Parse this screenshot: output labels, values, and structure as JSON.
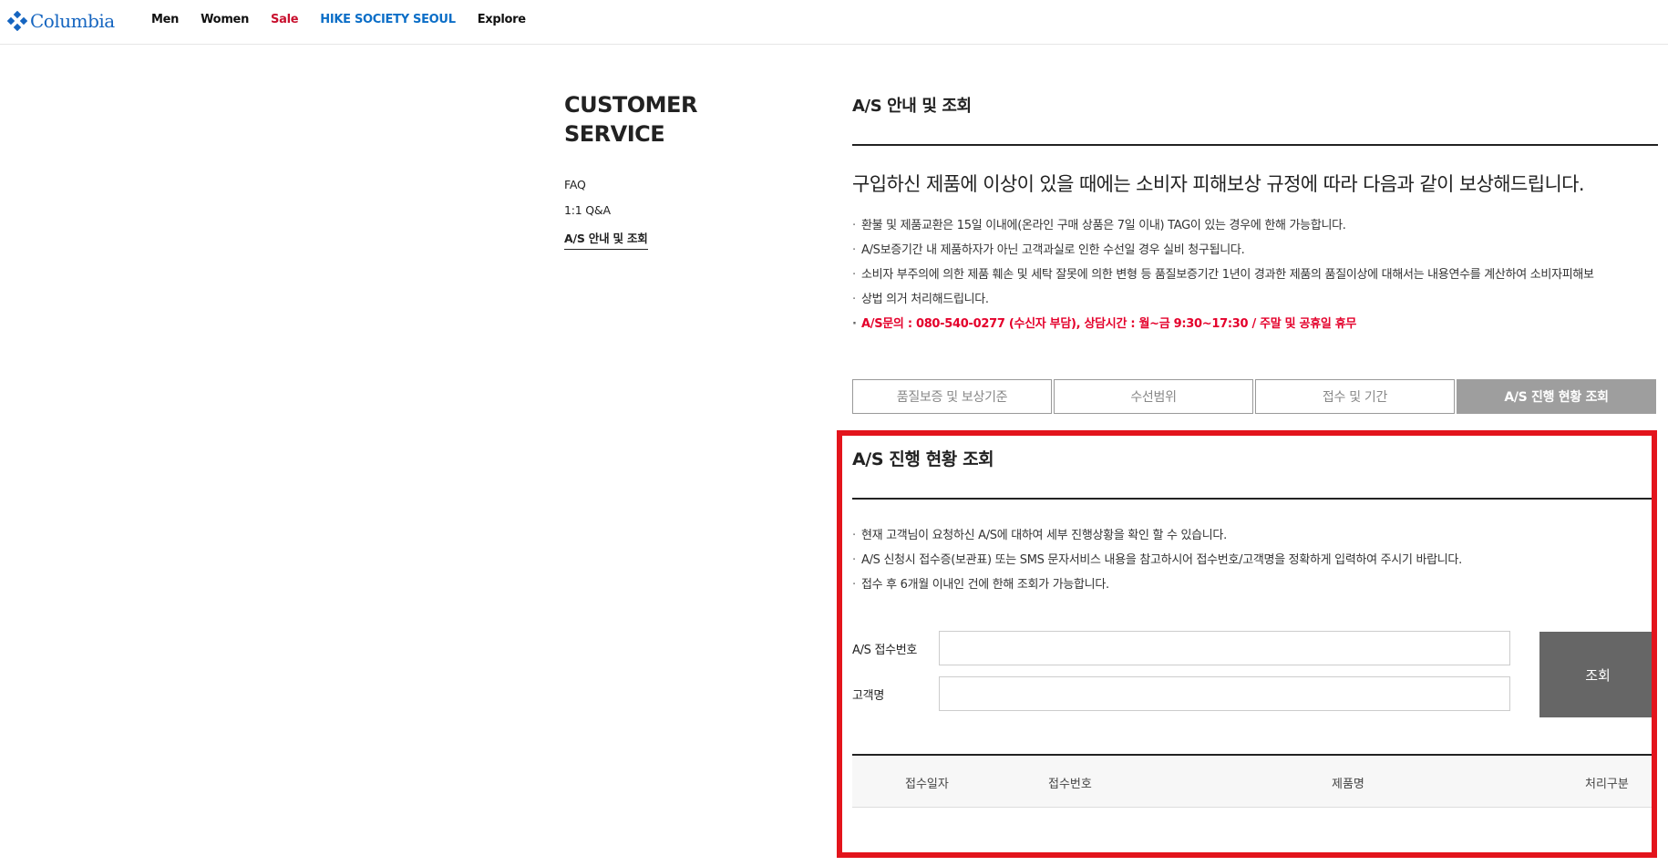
{
  "brand": {
    "name": "Columbia",
    "color": "#1565c0"
  },
  "nav": [
    {
      "label": "Men",
      "style": "normal"
    },
    {
      "label": "Women",
      "style": "normal"
    },
    {
      "label": "Sale",
      "style": "sale"
    },
    {
      "label": "HIKE SOCIETY SEOUL",
      "style": "hike"
    },
    {
      "label": "Explore",
      "style": "normal"
    }
  ],
  "sidebar": {
    "title_line1": "CUSTOMER",
    "title_line2": "SERVICE",
    "items": [
      {
        "label": "FAQ"
      },
      {
        "label": "1:1 Q&A"
      },
      {
        "label": "A/S 안내 및 조회"
      }
    ]
  },
  "main": {
    "title": "A/S 안내 및 조회",
    "headline": "구입하신 제품에 이상이 있을 때에는 소비자 피해보상 규정에 따라 다음과 같이 보상해드립니다.",
    "notes": [
      "환불 및 제품교환은 15일 이내에(온라인 구매 상품은 7일 이내) TAG이 있는 경우에 한해 가능합니다.",
      "A/S보증기간 내 제품하자가 아닌 고객과실로 인한 수선일 경우 실비 청구됩니다.",
      "소비자 부주의에 의한 제품 훼손 및 세탁 잘못에 의한 변형 등 품질보증기간 1년이 경과한 제품의 품질이상에 대해서는 내용연수를 계산하여 소비자피해보",
      "상법 의거 처리해드립니다."
    ],
    "contact": "A/S문의 : 080-540-0277 (수신자 부담), 상담시간 : 월~금 9:30~17:30 / 주말 및 공휴일 휴무",
    "tabs": [
      {
        "label": "품질보증 및 보상기준"
      },
      {
        "label": "수선범위"
      },
      {
        "label": "접수 및 기간"
      },
      {
        "label": "A/S 진행 현황 조회"
      }
    ]
  },
  "status": {
    "title": "A/S 진행 현황 조회",
    "notes": [
      "현재 고객님이 요청하신 A/S에 대하여 세부 진행상황을 확인 할 수 있습니다.",
      "A/S 신청시 접수증(보관표) 또는 SMS 문자서비스 내용을 참고하시어 접수번호/고객명을 정확하게 입력하여 주시기 바랍니다.",
      "접수 후 6개월 이내인 건에 한해 조회가 가능합니다."
    ],
    "form": {
      "receipt_label": "A/S 접수번호",
      "receipt_value": "",
      "name_label": "고객명",
      "name_value": "",
      "search_label": "조회"
    },
    "table_headers": [
      "접수일자",
      "접수번호",
      "제품명",
      "처리구분"
    ]
  }
}
